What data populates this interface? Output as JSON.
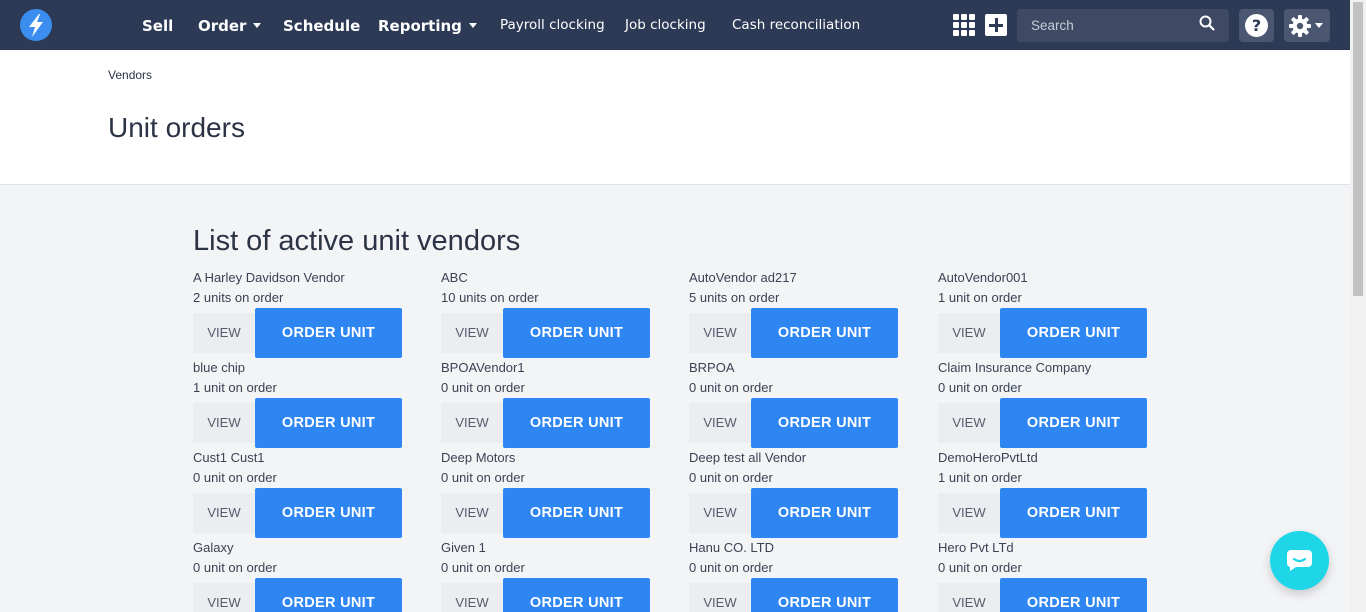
{
  "nav": {
    "main_items": [
      {
        "label": "Sell",
        "dropdown": false
      },
      {
        "label": "Order",
        "dropdown": true
      },
      {
        "label": "Schedule",
        "dropdown": false
      },
      {
        "label": "Reporting",
        "dropdown": true
      }
    ],
    "sub_items": [
      "Payroll clocking",
      "Job clocking",
      "Cash reconciliation"
    ],
    "search_placeholder": "Search",
    "help_label": "?",
    "icons": {
      "logo": "lightning-bolt-icon",
      "apps": "grid-icon",
      "add": "plus-icon",
      "search": "search-icon",
      "help": "help-icon",
      "settings": "gear-icon",
      "chat": "chat-icon"
    }
  },
  "header": {
    "breadcrumb": "Vendors",
    "title": "Unit orders"
  },
  "content": {
    "section_title": "List of active unit vendors",
    "view_label": "VIEW",
    "order_label": "ORDER UNIT",
    "vendors": [
      {
        "name": "A Harley Davidson Vendor",
        "count": "2 units on order"
      },
      {
        "name": "ABC",
        "count": "10 units on order"
      },
      {
        "name": "AutoVendor ad217",
        "count": "5 units on order"
      },
      {
        "name": "AutoVendor001",
        "count": "1 unit on order"
      },
      {
        "name": "blue chip",
        "count": "1 unit on order"
      },
      {
        "name": "BPOAVendor1",
        "count": "0 unit on order"
      },
      {
        "name": "BRPOA",
        "count": "0 unit on order"
      },
      {
        "name": "Claim Insurance Company",
        "count": "0 unit on order"
      },
      {
        "name": "Cust1 Cust1",
        "count": "0 unit on order"
      },
      {
        "name": "Deep Motors",
        "count": "0 unit on order"
      },
      {
        "name": "Deep test all Vendor",
        "count": "0 unit on order"
      },
      {
        "name": "DemoHeroPvtLtd",
        "count": "1 unit on order"
      },
      {
        "name": "Galaxy",
        "count": "0 unit on order"
      },
      {
        "name": "Given 1",
        "count": "0 unit on order"
      },
      {
        "name": "Hanu CO. LTD",
        "count": "0 unit on order"
      },
      {
        "name": "Hero Pvt LTd",
        "count": "0 unit on order"
      }
    ]
  },
  "colors": {
    "nav_bg": "#2d3a55",
    "accent": "#2e86f2",
    "chat": "#1ed6e8",
    "page_bg": "#f3f4f6"
  }
}
